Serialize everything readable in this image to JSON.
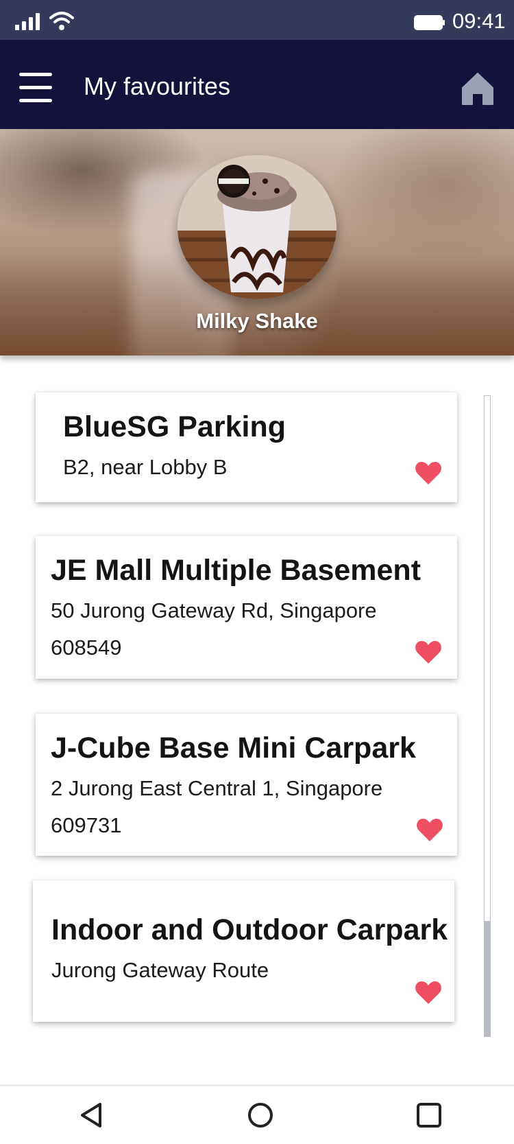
{
  "status_bar": {
    "time": "09:41",
    "icons": [
      "signal-icon",
      "wifi-icon",
      "battery-icon"
    ]
  },
  "header": {
    "title": "My favourites",
    "menu_icon": "menu-icon",
    "home_icon": "home-icon",
    "background": "#12123a"
  },
  "hero": {
    "caption": "Milky Shake",
    "avatar_image": "milkshake-photo"
  },
  "favourites": [
    {
      "name": "BlueSG Parking",
      "address": "B2, near Lobby B",
      "favourite_icon": "heart-icon"
    },
    {
      "name": "JE Mall Multiple Basement",
      "address": "50 Jurong Gateway Rd, Singapore 608549",
      "favourite_icon": "heart-icon"
    },
    {
      "name": "J-Cube Base Mini Carpark",
      "address": "2 Jurong East Central 1, Singapore 609731",
      "favourite_icon": "heart-icon"
    },
    {
      "name": "Indoor and Outdoor Carpark",
      "address": "Jurong Gateway Route",
      "favourite_icon": "heart-icon"
    }
  ],
  "nav_bar": {
    "icons": [
      "back-icon",
      "home-circle-icon",
      "recent-apps-icon"
    ]
  },
  "colors": {
    "status_bar": "#353a5a",
    "app_bar": "#12123a",
    "heart": "#ee4f63",
    "home_icon": "#9aa3b3",
    "scrollbar": "#b9bcc4"
  }
}
